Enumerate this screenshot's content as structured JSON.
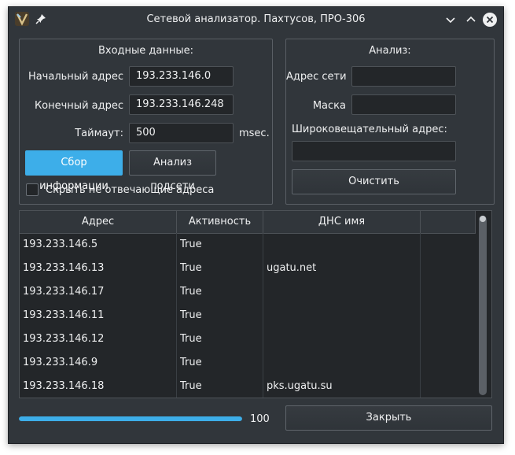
{
  "window": {
    "title": "Сетевой анализатор. Пахтусов, ПРО-306"
  },
  "input_group": {
    "title": "Входные данные:",
    "start_label": "Начальный адрес",
    "start_value": "193.233.146.0",
    "end_label": "Конечный адрес",
    "end_value": "193.233.146.248",
    "timeout_label": "Таймаут:",
    "timeout_value": "500",
    "timeout_unit": "msec.",
    "collect_button": "Сбор информации",
    "analyze_button": "Анализ подсети",
    "hide_checkbox_label": "Скрыть не отвечающие адреса",
    "hide_checkbox_checked": false
  },
  "analysis_group": {
    "title": "Анализ:",
    "network_label": "Адрес сети",
    "network_value": "",
    "mask_label": "Маска",
    "mask_value": "",
    "broadcast_label": "Широковещательный адрес:",
    "broadcast_value": "",
    "clear_button": "Очистить"
  },
  "table": {
    "columns": [
      "Адрес",
      "Активность",
      "ДНС имя",
      ""
    ],
    "rows": [
      [
        "193.233.146.5",
        "True",
        ""
      ],
      [
        "193.233.146.13",
        "True",
        "ugatu.net"
      ],
      [
        "193.233.146.17",
        "True",
        ""
      ],
      [
        "193.233.146.11",
        "True",
        ""
      ],
      [
        "193.233.146.12",
        "True",
        ""
      ],
      [
        "193.233.146.9",
        "True",
        ""
      ],
      [
        "193.233.146.18",
        "True",
        "pks.ugatu.su"
      ]
    ]
  },
  "footer": {
    "progress_value": 100,
    "progress_text": "100",
    "close_button": "Закрыть"
  },
  "colors": {
    "accent": "#3daee9",
    "background": "#31363b",
    "field": "#232629"
  },
  "icons": [
    "app-icon",
    "pin-icon",
    "minimize-icon",
    "maximize-icon",
    "close-icon"
  ]
}
